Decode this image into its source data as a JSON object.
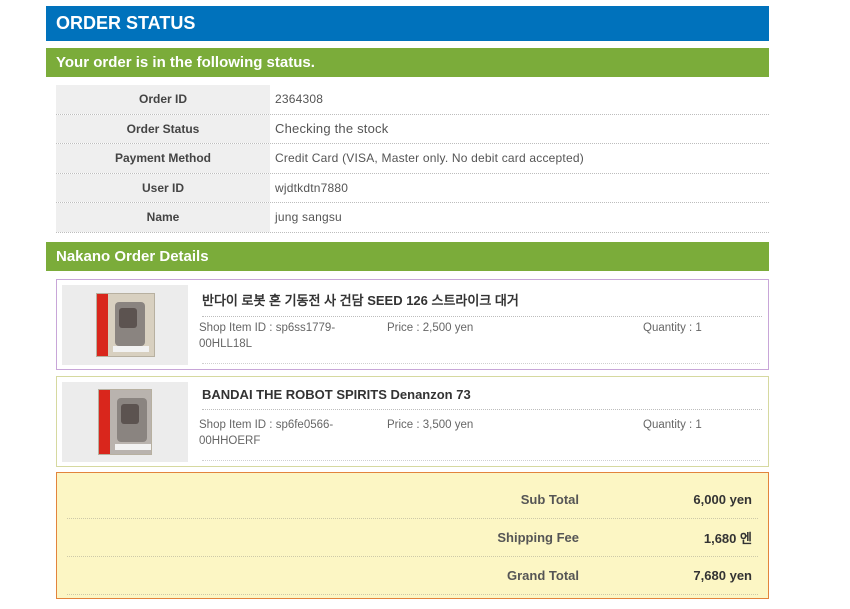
{
  "header": {
    "title": "ORDER STATUS"
  },
  "status_section": {
    "title": "Your order is in the following status.",
    "rows": [
      {
        "label": "Order ID",
        "value": "2364308"
      },
      {
        "label": "Order Status",
        "value": "Checking the stock"
      },
      {
        "label": "Payment Method",
        "value": "Credit Card (VISA, Master only. No debit card accepted)"
      },
      {
        "label": "User ID",
        "value": "wjdtkdtn7880"
      },
      {
        "label": "Name",
        "value": "jung  sangsu"
      }
    ]
  },
  "details_section": {
    "title": "Nakano Order Details",
    "items": [
      {
        "name": "반다이 로봇 혼 기동전 사 건담 SEED 126 스트라이크 대거",
        "shop_item_label": "Shop Item ID : sp6ss1779-",
        "shop_item_cont": "00HLL18L",
        "price": "Price : 2,500 yen",
        "quantity": "Quantity : 1"
      },
      {
        "name": "BANDAI THE ROBOT SPIRITS Denanzon 73",
        "shop_item_label": "Shop Item ID : sp6fe0566-",
        "shop_item_cont": "00HHOERF",
        "price": "Price : 3,500 yen",
        "quantity": "Quantity : 1"
      }
    ]
  },
  "totals": {
    "sub_total": {
      "label": "Sub Total",
      "value": "6,000",
      "unit": "yen"
    },
    "shipping": {
      "label": "Shipping Fee",
      "value": "1,680",
      "unit": "엔"
    },
    "grand_total": {
      "label": "Grand Total",
      "value": "7,680",
      "unit": "yen"
    }
  },
  "colors": {
    "header_blue": "#0072bc",
    "section_green": "#7bac3a",
    "totals_bg": "#fcf6c4",
    "totals_border": "#e2843c"
  }
}
